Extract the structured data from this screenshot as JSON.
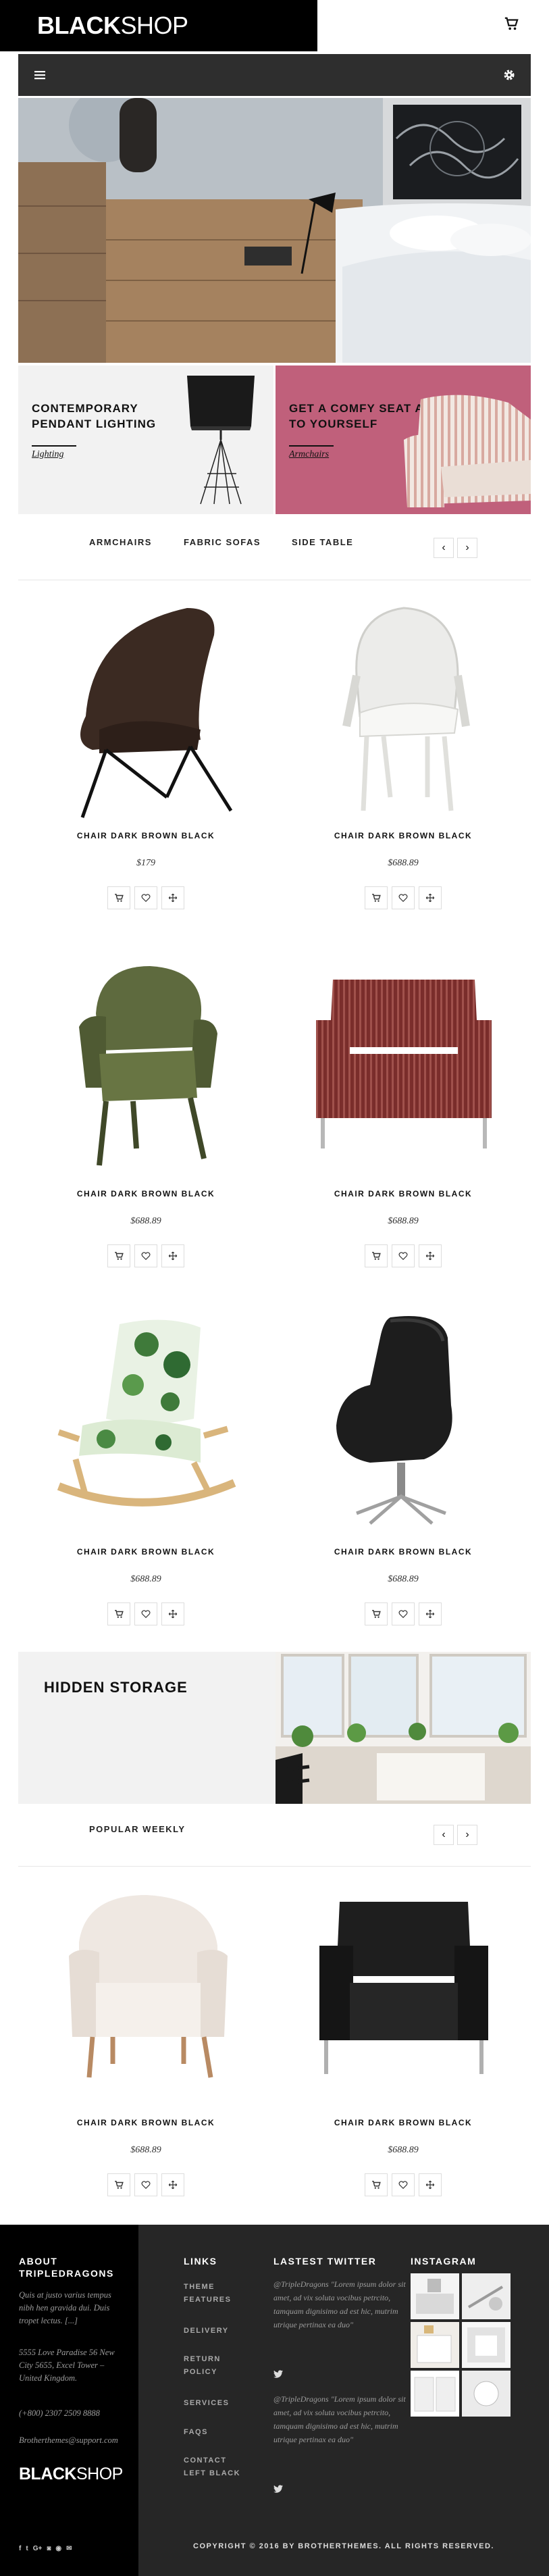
{
  "header": {
    "logo_bold": "BLACK",
    "logo_light": "SHOP",
    "cart_icon": "cart-icon"
  },
  "navbar": {
    "menu_icon": "hamburger-icon",
    "settings_icon": "gear-icon"
  },
  "promos": [
    {
      "title": "CONTEMPORARY PENDANT LIGHTING",
      "link": "Lighting"
    },
    {
      "title": "GET A COMFY SEAT ALL TO YOURSELF",
      "link": "Armchairs"
    }
  ],
  "tabs": [
    "ARMCHAIRS",
    "FABRIC SOFAS",
    "SIDE TABLE"
  ],
  "arrows": {
    "prev": "‹",
    "next": "›"
  },
  "products": [
    {
      "name": "CHAIR DARK BROWN BLACK",
      "price": "$179"
    },
    {
      "name": "CHAIR DARK BROWN BLACK",
      "price": "$688.89"
    },
    {
      "name": "CHAIR DARK BROWN BLACK",
      "price": "$688.89"
    },
    {
      "name": "CHAIR DARK BROWN BLACK",
      "price": "$688.89"
    },
    {
      "name": "CHAIR DARK BROWN BLACK",
      "price": "$688.89"
    },
    {
      "name": "CHAIR DARK BROWN BLACK",
      "price": "$688.89"
    }
  ],
  "storage": {
    "title": "HIDDEN STORAGE"
  },
  "popular": {
    "title": "POPULAR WEEKLY",
    "products": [
      {
        "name": "CHAIR DARK BROWN BLACK",
        "price": "$688.89"
      },
      {
        "name": "CHAIR DARK BROWN BLACK",
        "price": "$688.89"
      }
    ]
  },
  "footer": {
    "about": {
      "heading_line1": "ABOUT",
      "heading_line2": "TRIPLEDRAGONS",
      "text": "Quis at justo varius tempus nibh hen gravida dui. Duis tropet lectus. [...]",
      "address": "5555 Love Paradise 56 New City 5655, Excel Tower – United Kingdom.",
      "phone": "(+800) 2307 2509 8888",
      "email": "Brotherthemes@support.com",
      "logo_bold": "BLACK",
      "logo_light": "SHOP"
    },
    "links": {
      "heading": "LINKS",
      "items": [
        "THEME FEATURES",
        "DELIVERY",
        "RETURN POLICY",
        "SERVICES",
        "FAQS",
        "CONTACT LEFT BLACK"
      ]
    },
    "twitter": {
      "heading": "LASTEST TWITTER",
      "tweets": [
        "@TripleDragons \"Lorem ipsum dolor sit amet, ad vix soluta vocibus petrcito, tamquam dignisimo ad est hic, mutrim utrique pertinax ea duo\"",
        "@TripleDragons \"Lorem ipsum dolor sit amet, ad vix soluta vocibus petrcito, tamquam dignisimo ad est hic, mutrim utrique pertinax ea duo\""
      ]
    },
    "instagram": {
      "heading": "INSTAGRAM"
    },
    "socials": [
      "f",
      "t",
      "G+",
      "◙",
      "◉",
      "✉"
    ],
    "copyright": "COPYRIGHT © 2016 BY BROTHERTHEMES. ALL RIGHTS RESERVED."
  },
  "colors": {
    "black": "#000000",
    "navbar": "#2e2e2e",
    "promo_pink": "#c0607b",
    "footer": "#262626"
  }
}
